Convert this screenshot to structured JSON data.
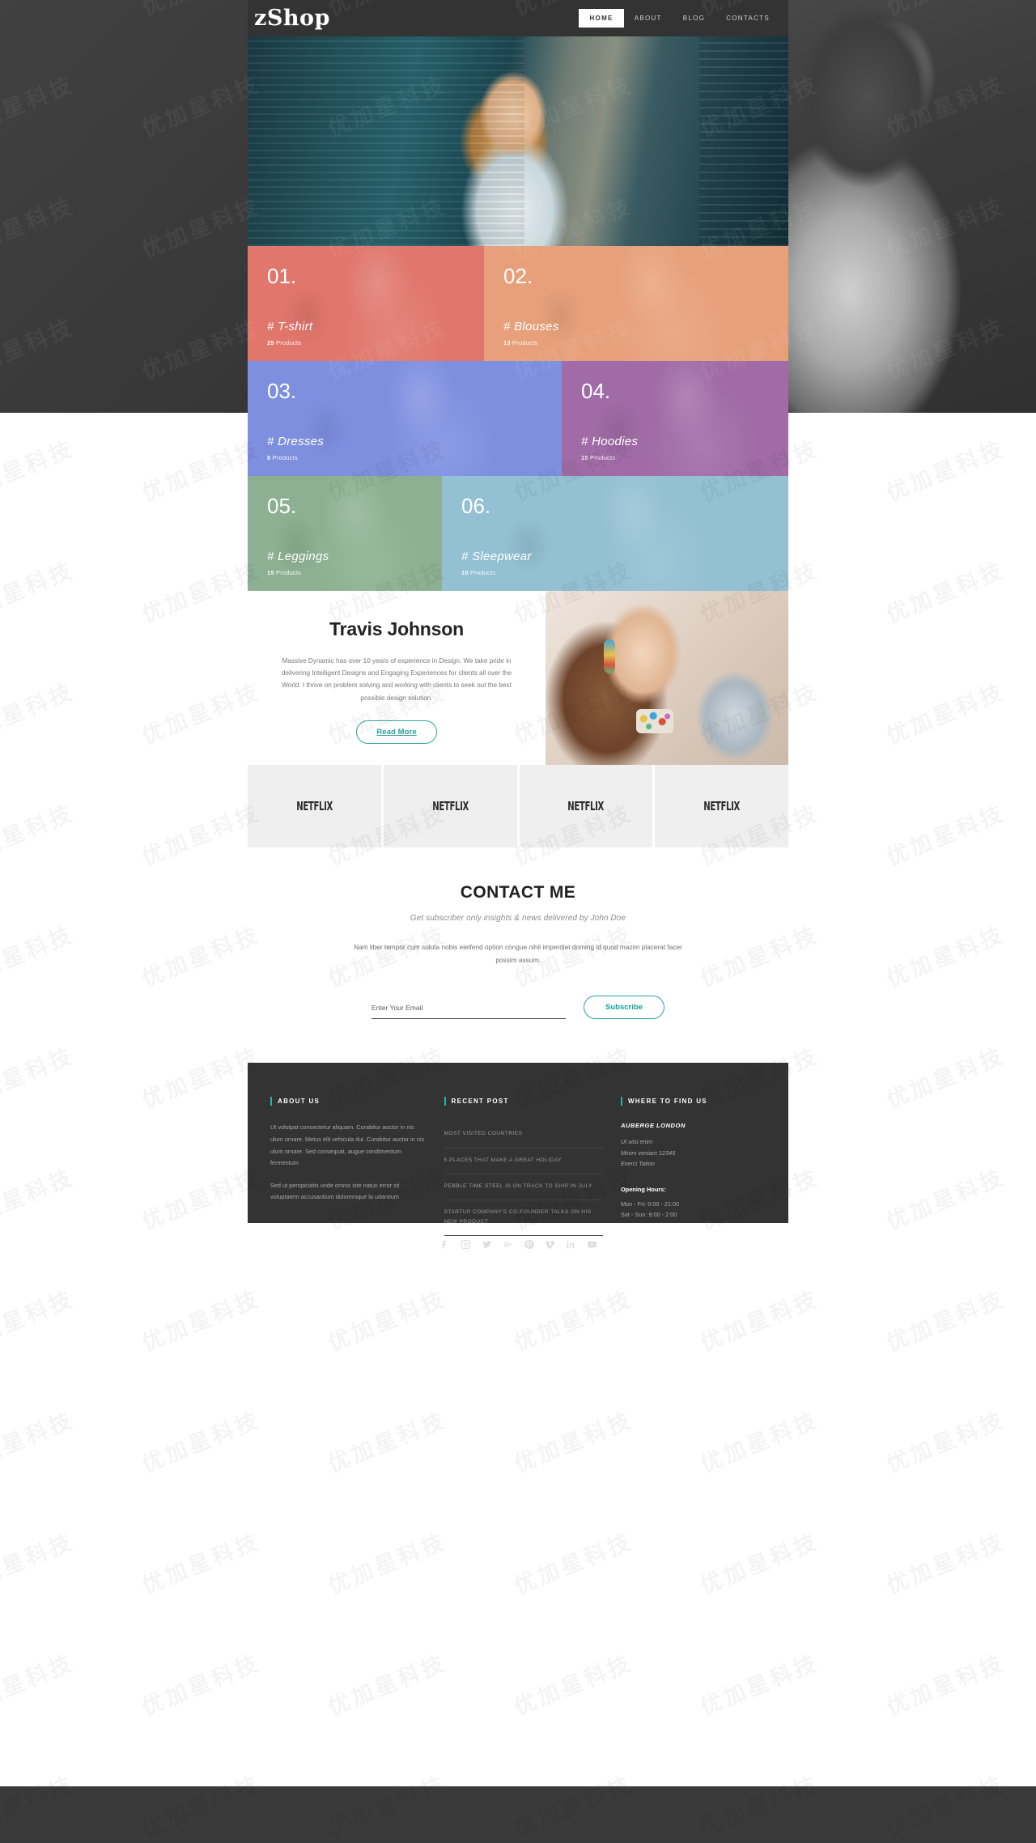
{
  "header": {
    "logo": "zShop",
    "nav": [
      {
        "label": "HOME",
        "active": true
      },
      {
        "label": "ABOUT",
        "active": false
      },
      {
        "label": "BLOG",
        "active": false
      },
      {
        "label": "CONTACTS",
        "active": false
      }
    ]
  },
  "categories": [
    {
      "num": "01.",
      "name": "# T-shirt",
      "count": "25",
      "count_label": "Products",
      "color": "#e0766c"
    },
    {
      "num": "02.",
      "name": "# Blouses",
      "count": "13",
      "count_label": "Products",
      "color": "#e8a07a"
    },
    {
      "num": "03.",
      "name": "# Dresses",
      "count": "8",
      "count_label": "Products",
      "color": "#7f8fe0"
    },
    {
      "num": "04.",
      "name": "# Hoodies",
      "count": "15",
      "count_label": "Products",
      "color": "#a06ba6"
    },
    {
      "num": "05.",
      "name": "# Leggings",
      "count": "15",
      "count_label": "Products",
      "color": "#8cb091"
    },
    {
      "num": "06.",
      "name": "# Sleepwear",
      "count": "10",
      "count_label": "Products",
      "color": "#93c0d2"
    }
  ],
  "about": {
    "name": "Travis Johnson",
    "bio": "Massive Dynamic has over 10 years of experience in Design. We take pride in delivering Intelligent Designs and Engaging Experiences for clients all over the World. I thrive on problem solving and working with clients to seek out the best possible design solution.",
    "button": "Read More"
  },
  "brands": [
    {
      "name": "NETFLIX"
    },
    {
      "name": "NETFLIX"
    },
    {
      "name": "NETFLIX"
    },
    {
      "name": "NETFLIX"
    }
  ],
  "contact": {
    "title": "CONTACT ME",
    "subtitle": "Get subscriber only insights & news delivered by John Doe",
    "lead": "Nam liber tempor cum soluta nobis eleifend option congue nihil imperdiet doming id quod mazim placerat facer possim assum.",
    "email_placeholder": "Enter Your Email",
    "email_value": "",
    "subscribe_label": "Subscribe"
  },
  "footer": {
    "about": {
      "heading": "ABOUT US",
      "paragraphs": [
        "Ut volutpat consectetur aliquam. Curabitur auctor in nis ulum ornare. Metus elit vehicula dui. Curabitur auctor in nis ulum ornare. Sed consequat, augue condimentum fermentum",
        "Sed ut perspiciatis unde omnis iste natus error sit voluptatem accusantium doloremque la udantium"
      ]
    },
    "recent": {
      "heading": "RECENT POST",
      "posts": [
        "MOST VISITED COUNTRIES",
        "5 PLACES THAT MAKE A GREAT HOLIDAY",
        "PEBBLE TIME STEEL IS ON TRACK TO SHIP IN JULY",
        "STARTUP COMPANY'S CO-FOUNDER TALKS ON HIS NEW PRODUCT"
      ]
    },
    "find_us": {
      "heading": "WHERE TO FIND US",
      "place": "AUBERGE LONDON",
      "lines": [
        "Ut wisi enim",
        "Minim veniam 12345",
        "Exerci Tation"
      ],
      "hours_title": "Opening Hours:",
      "hours": [
        "Mon - Fri: 9:00 - 21:00",
        "Sat - Sun: 9:00 - 2:00"
      ]
    }
  },
  "socials": [
    {
      "name": "facebook-icon"
    },
    {
      "name": "instagram-icon"
    },
    {
      "name": "twitter-icon"
    },
    {
      "name": "google-plus-icon"
    },
    {
      "name": "pinterest-icon"
    },
    {
      "name": "vimeo-icon"
    },
    {
      "name": "linkedin-icon"
    },
    {
      "name": "youtube-icon"
    }
  ],
  "theme": {
    "accent": "#26b5a6",
    "dark": "#333333",
    "page_bg": "#3a3a3a"
  },
  "watermark": {
    "text": "优加星科技"
  }
}
